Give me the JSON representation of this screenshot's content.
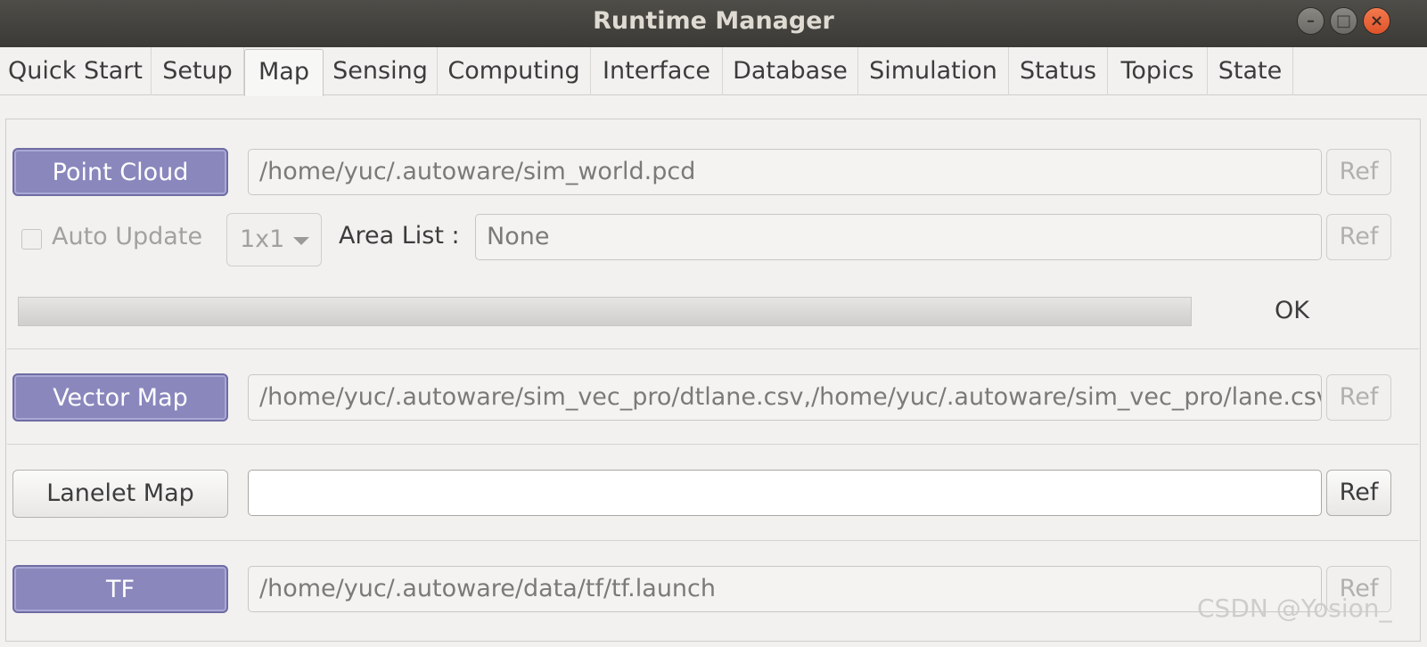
{
  "window": {
    "title": "Runtime Manager"
  },
  "tabs": [
    {
      "label": "Quick Start"
    },
    {
      "label": "Setup"
    },
    {
      "label": "Map"
    },
    {
      "label": "Sensing"
    },
    {
      "label": "Computing"
    },
    {
      "label": "Interface"
    },
    {
      "label": "Database"
    },
    {
      "label": "Simulation"
    },
    {
      "label": "Status"
    },
    {
      "label": "Topics"
    },
    {
      "label": "State"
    }
  ],
  "active_tab": "Map",
  "point_cloud": {
    "button_label": "Point Cloud",
    "active": true,
    "path": "/home/yuc/.autoware/sim_world.pcd",
    "ref_label": "Ref",
    "auto_update_label": "Auto Update",
    "auto_update_checked": false,
    "grid_select": "1x1",
    "area_list_label": "Area List :",
    "area_list_value": "None",
    "area_ref_label": "Ref",
    "progress": 0,
    "status": "OK"
  },
  "vector_map": {
    "button_label": "Vector Map",
    "active": true,
    "path": "/home/yuc/.autoware/sim_vec_pro/dtlane.csv,/home/yuc/.autoware/sim_vec_pro/lane.csv",
    "ref_label": "Ref"
  },
  "lanelet_map": {
    "button_label": "Lanelet Map",
    "active": false,
    "path": "",
    "ref_label": "Ref"
  },
  "tf": {
    "button_label": "TF",
    "active": true,
    "path": "/home/yuc/.autoware/data/tf/tf.launch",
    "ref_label": "Ref"
  },
  "watermark": "CSDN @Yosion_",
  "colors": {
    "active_button": "#8a87bd",
    "titlebar": "#3b3a36",
    "close_button": "#e0532a"
  }
}
